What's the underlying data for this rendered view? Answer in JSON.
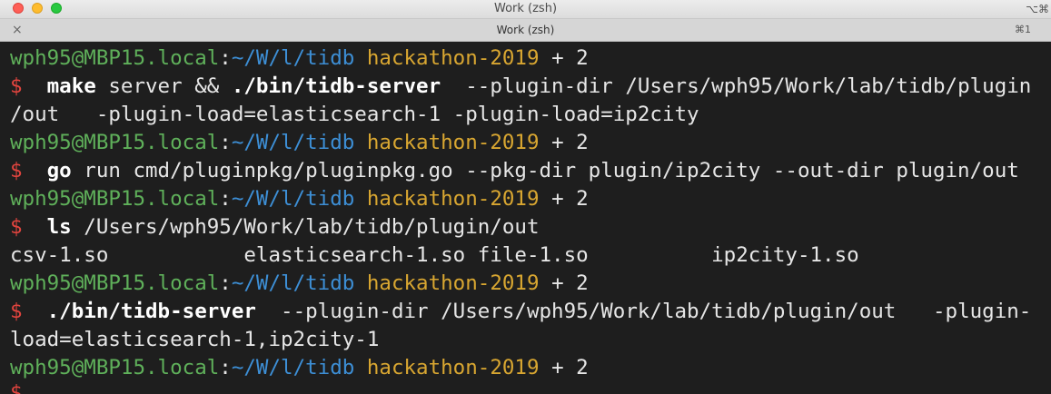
{
  "window": {
    "title": "Work (zsh)",
    "shortcut_hint": "⌥⌘"
  },
  "tab": {
    "title": "Work (zsh)",
    "shortcut": "⌘1",
    "close_glyph": "×"
  },
  "prompt": {
    "user_host": "wph95@MBP15.local",
    "sep": ":",
    "path": "~/W/l/tidb",
    "branch": "hackathon-2019",
    "dirty": "+ 2",
    "symbol": "$"
  },
  "commands": {
    "c1_program": "make",
    "c1_args": " server && ",
    "c1_bin": "./bin/tidb-server",
    "c1_rest": "  --plugin-dir /Users/wph95/Work/lab/tidb/plugin",
    "c1_wrap": "/out   -plugin-load=elasticsearch-1 -plugin-load=ip2city",
    "c2_program": "go",
    "c2_rest": " run cmd/pluginpkg/pluginpkg.go --pkg-dir plugin/ip2city --out-dir plugin/out",
    "c3_program": "ls",
    "c3_rest": " /Users/wph95/Work/lab/tidb/plugin/out",
    "c3_output": "csv-1.so           elasticsearch-1.so file-1.so          ip2city-1.so",
    "c4_program": "./bin/tidb-server",
    "c4_rest": "  --plugin-dir /Users/wph95/Work/lab/tidb/plugin/out   -plugin-",
    "c4_wrap": "load=elasticsearch-1,ip2city-1"
  },
  "colors": {
    "user": "#5fb05a",
    "path": "#3d8fd6",
    "branch": "#d8a631",
    "dollar": "#e0443e",
    "background": "#1e1e1e"
  }
}
